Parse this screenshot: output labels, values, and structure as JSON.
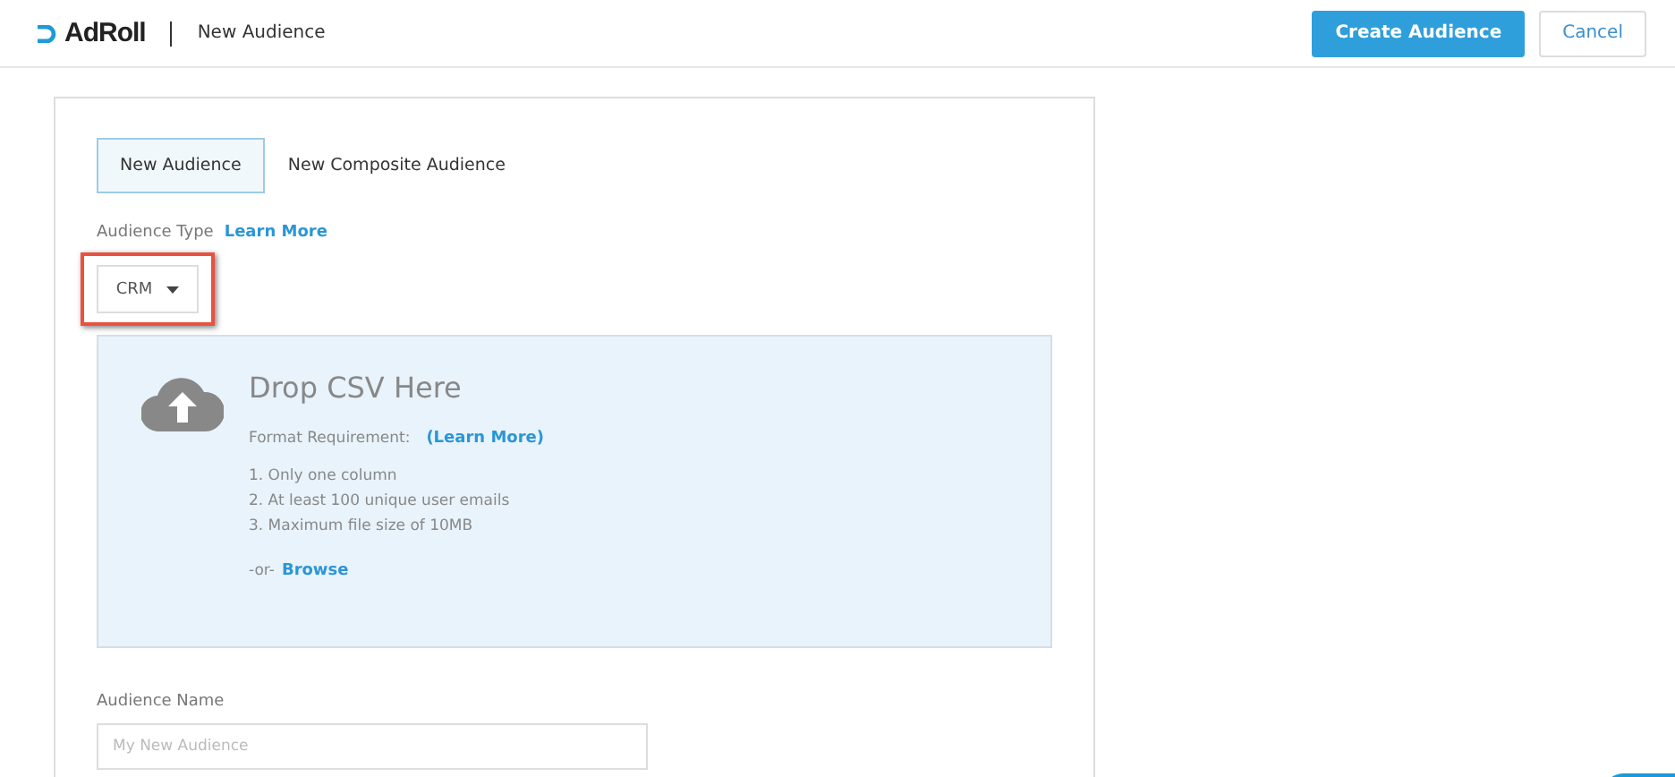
{
  "header": {
    "logo": "AdRoll",
    "title": "New Audience",
    "buttons": [
      {
        "label": "Create Audience",
        "kind": "primary"
      },
      {
        "label": "Cancel",
        "kind": "secondary"
      }
    ]
  },
  "tabs": [
    {
      "label": "New Audience",
      "selected": true
    },
    {
      "label": "New Composite Audience",
      "selected": false
    }
  ],
  "audience_type": {
    "label": "Audience Type",
    "link": "Learn More",
    "value": "CRM",
    "highlighted": true
  },
  "drop_zone": {
    "title": "Drop CSV Here",
    "requirement_label": "Format Requirement:",
    "requirement_link": "(Learn More)",
    "requirements": [
      "1. Only one column",
      "2. At least 100 unique user emails",
      "3. Maximum file size of 10MB"
    ],
    "or_text": "-or-",
    "browse": "Browse"
  },
  "audience_name": {
    "label": "Audience Name",
    "placeholder": "My New Audience"
  }
}
